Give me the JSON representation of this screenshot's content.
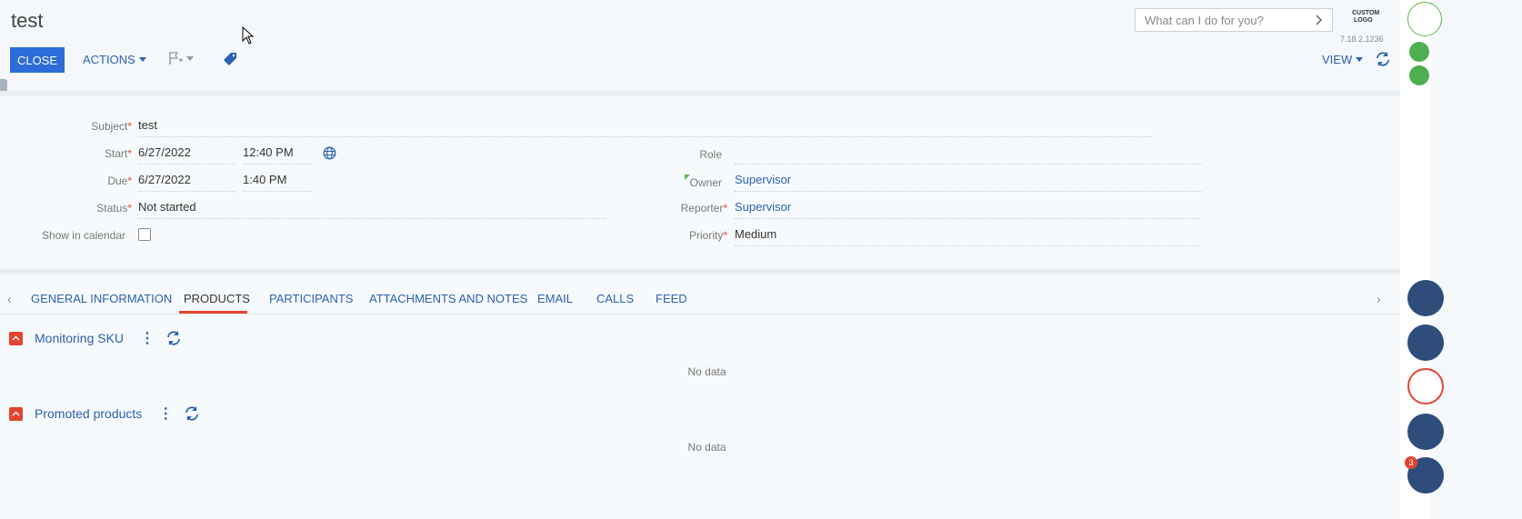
{
  "header": {
    "title": "test",
    "close_label": "CLOSE",
    "actions_label": "ACTIONS",
    "view_label": "VIEW",
    "search_placeholder": "What can I do for you?",
    "logo_line1": "CUSTOM",
    "logo_line2": "LOGO",
    "version": "7.18.2.1236"
  },
  "form": {
    "subject": {
      "label": "Subject",
      "value": "test"
    },
    "start": {
      "label": "Start",
      "date": "6/27/2022",
      "time": "12:40 PM"
    },
    "due": {
      "label": "Due",
      "date": "6/27/2022",
      "time": "1:40 PM"
    },
    "status": {
      "label": "Status",
      "value": "Not started"
    },
    "show_in_calendar": {
      "label": "Show in calendar",
      "checked": false
    },
    "role": {
      "label": "Role",
      "value": ""
    },
    "owner": {
      "label": "Owner",
      "value": "Supervisor"
    },
    "reporter": {
      "label": "Reporter",
      "value": "Supervisor"
    },
    "priority": {
      "label": "Priority",
      "value": "Medium"
    },
    "required_mark": "*"
  },
  "tabs": [
    {
      "label": "GENERAL INFORMATION"
    },
    {
      "label": "PRODUCTS"
    },
    {
      "label": "PARTICIPANTS"
    },
    {
      "label": "ATTACHMENTS AND NOTES"
    },
    {
      "label": "EMAIL"
    },
    {
      "label": "CALLS"
    },
    {
      "label": "FEED"
    }
  ],
  "sections": [
    {
      "title": "Monitoring SKU",
      "empty_text": "No data"
    },
    {
      "title": "Promoted products",
      "empty_text": "No data"
    }
  ],
  "rail": {
    "notification_count": "3"
  },
  "colors": {
    "accent": "#2b6cd8",
    "link": "#2b5fb0",
    "required": "#e4442f",
    "rail": "#2e4d7b"
  }
}
